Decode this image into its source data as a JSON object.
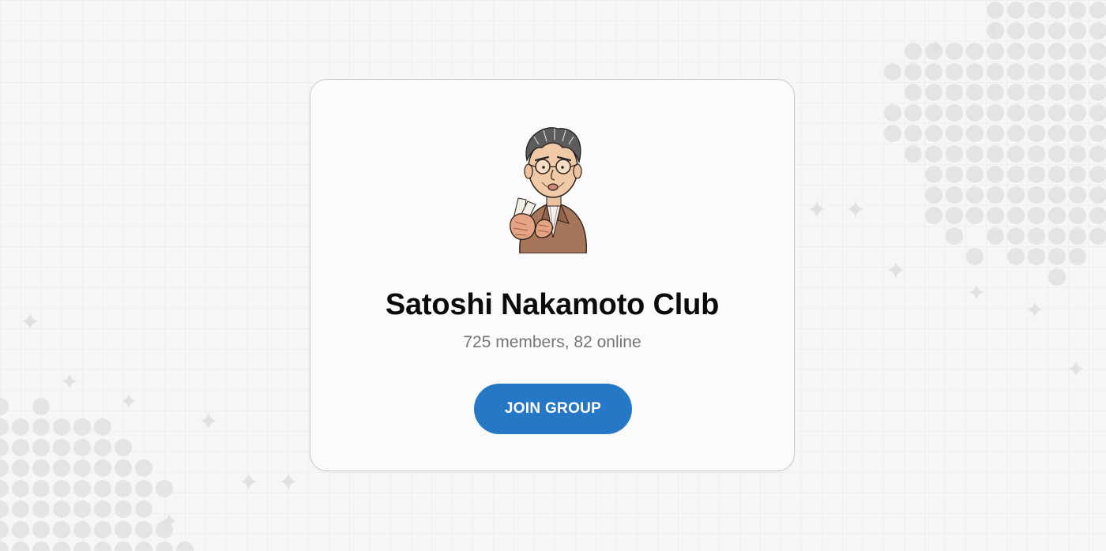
{
  "group": {
    "name": "Satoshi Nakamoto Club",
    "stats": "725 members, 82 online"
  },
  "actions": {
    "join_label": "JOIN GROUP"
  },
  "colors": {
    "accent": "#2678c6",
    "background": "#f6f6f6",
    "card": "#fbfbfb",
    "pattern": "#e4e4e4"
  },
  "icons": {
    "avatar": "satoshi-caricature-avatar"
  }
}
